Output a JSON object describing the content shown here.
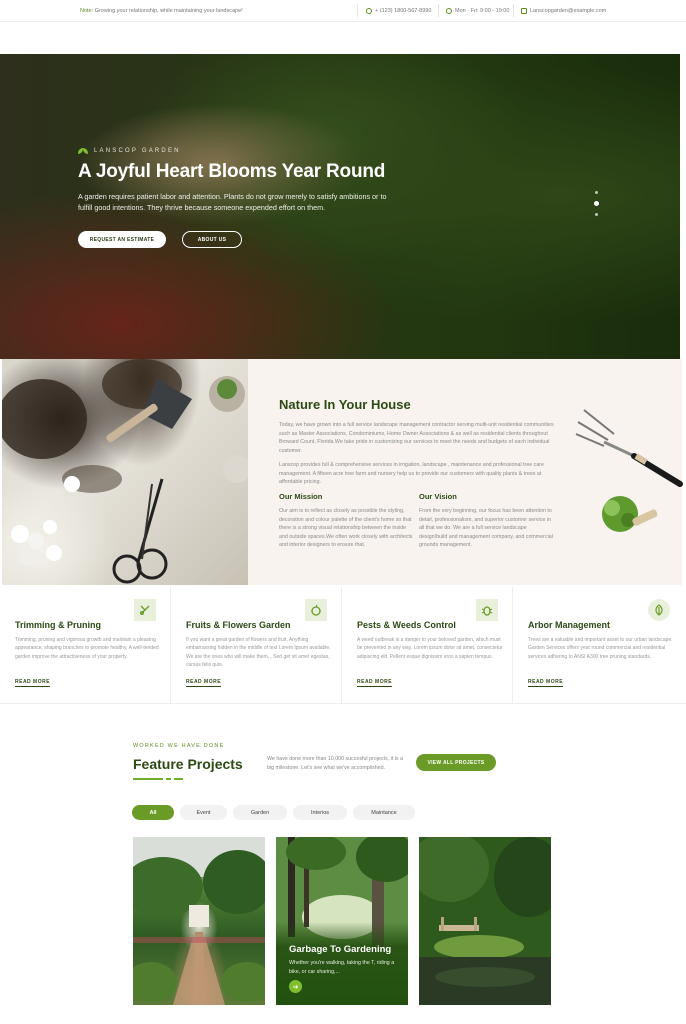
{
  "topbar": {
    "note_label": "Note:",
    "note_text": "Growing your relationship, while maintaining your landscape!",
    "phone": "+ (123) 1800-567-8990",
    "hours": "Mon - Fri: 9:00 - 19:00",
    "email": "Lanscopgarden@example.com"
  },
  "hero": {
    "brand": "LANSCOP GARDEN",
    "title": "A Joyful Heart Blooms Year Round",
    "text": "A garden requires patient labor and attention. Plants do not grow merely to satisfy ambitions or to fulfill good intentions. They thrive because someone expended effort on them.",
    "btn_estimate": "REQUEST AN ESTIMATE",
    "btn_about": "ABOUT US",
    "slide_active": 2,
    "slide_count": 3
  },
  "about": {
    "title": "Nature In Your House",
    "p1": "Today, we have grown into a full service landscape management contractor serving multi-unit residential communities such as Master Associations, Condominiums, Home Owner Associations & as well as residential clients throughout Broward Count, Florida.We take pride in customizing our services to meet the needs and budgets of each individual customer.",
    "p2": "Lanscop provides full & comprehensive services in irrigation, landscape , maintenance and professional tree care management. A fifteen acre tree farm and nursery help us to provide our customers with quality plants & trees at affordable pricing.",
    "mission_title": "Our Mission",
    "mission_text": "Our aim is to reflect as closely as possible the styling, decoration and colour palette of the client's home so that there is a strong visual relationship between the inside and outside spaces.We often work closely with architects and interior designers to ensure that.",
    "vision_title": "Our Vision",
    "vision_text": "From the very beginning, our focus has been attention to detail, professionalism, and superior customer service in all that we do. We are a full service landscape design/build and management company, and commercial grounds management."
  },
  "services": [
    {
      "title": "Trimming & Pruning",
      "icon": "shears-icon",
      "text": "Trimming, pruning and vigorous growth and maintain a pleasing appearance, shaping branches to promote healthy, A well-tended garden improve the attractiveness of your property.",
      "link": "READ MORE"
    },
    {
      "title": "Fruits & Flowers Garden",
      "icon": "fruit-icon",
      "text": "If you want a great garden of flowers and fruit, Anything embarrassing hidden in the middle of text Lorem Ipsum available, We are the ones who will make them, , Sed get sit amet egestas, cursus felis quis.",
      "link": "READ MORE"
    },
    {
      "title": "Pests & Weeds Control",
      "icon": "bug-icon",
      "text": "A weed outbreak is a danger to your beloved garden, which must be prevented in any way. Lorem ipsum dolor sit amet, consectetur adipiscing elit. Pellent esque dignissim eros a sapien tempus.",
      "link": "READ MORE"
    },
    {
      "title": "Arbor Management",
      "icon": "leaf-icon",
      "text": "Trees are a valuable and important asset to our urban landscape. Garden Services offers year round commercial and residential services adhering to ANSI A300 tree pruning standards.",
      "link": "READ MORE"
    }
  ],
  "projects": {
    "eyebrow": "WORKED WE HAVE DONE",
    "title": "Feature Projects",
    "text": "We have done more than 10,000 succesful projects, it is a big milestone. Let's see what we've accomplished.",
    "btn": "VIEW ALL PROJECTS",
    "filters": [
      "All",
      "Event",
      "Garden",
      "Interios",
      "Maintance"
    ],
    "active_filter": "All",
    "featured_title": "Garbage To Gardening",
    "featured_text": "Whether you're walking, taking the T, riding a bike, or car sharing,...",
    "arrow": "➜"
  },
  "colors": {
    "accent": "#6a9b26",
    "dark_green": "#2c4a14",
    "panel_bg": "#f8f3ef"
  }
}
